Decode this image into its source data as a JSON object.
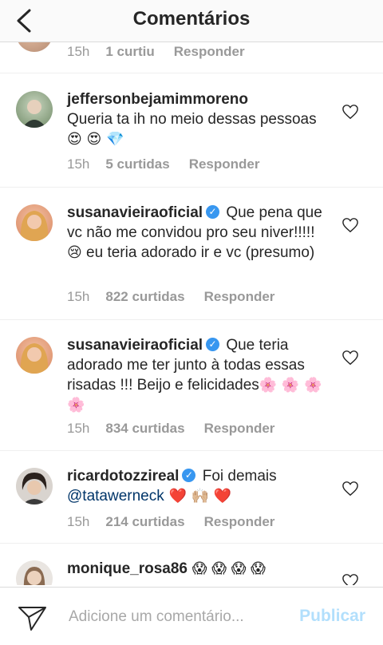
{
  "header": {
    "title": "Comentários"
  },
  "top_partial": {
    "time": "15h",
    "likes": "1 curtiu",
    "reply": "Responder"
  },
  "comments": [
    {
      "username": "jeffersonbejamimmoreno",
      "text": "Queria ta ih no meio dessas pessoas",
      "emojis": "😍 😍 💎",
      "time": "15h",
      "likes": "5 curtidas",
      "reply": "Responder"
    },
    {
      "username": "susanavieiraoficial",
      "text1": "Que pena que vc não me convidou pro seu niver!!!!!",
      "emoji1": "😢",
      "text2": " eu teria adorado ir e vc (presumo)",
      "time": "15h",
      "likes": "822 curtidas",
      "reply": "Responder"
    },
    {
      "username": "susanavieiraoficial",
      "text": "Que teria adorado me ter junto à todas essas risadas !!! Beijo e felicidades",
      "emojis": "🌸 🌸 🌸 🌸",
      "time": "15h",
      "likes": "834 curtidas",
      "reply": "Responder"
    },
    {
      "username": "ricardotozzireal",
      "text": "Foi demais",
      "mention": "@tatawerneck",
      "emojis": " ❤️ 🙌🏼 ❤️",
      "time": "15h",
      "likes": "214 curtidas",
      "reply": "Responder"
    },
    {
      "username": "monique_rosa86",
      "emojis": " 😱 😱 😱 😱"
    }
  ],
  "composer": {
    "placeholder": "Adicione um comentário...",
    "publish_label": "Publicar"
  },
  "icons": {
    "back": "chevron-left-icon",
    "heart": "heart-outline-icon",
    "send": "paper-plane-icon",
    "verified": "verified-badge-icon"
  },
  "colors": {
    "verified": "#3897f0",
    "publish": "#b2dffc",
    "meta": "#999999",
    "mention": "#003569"
  }
}
